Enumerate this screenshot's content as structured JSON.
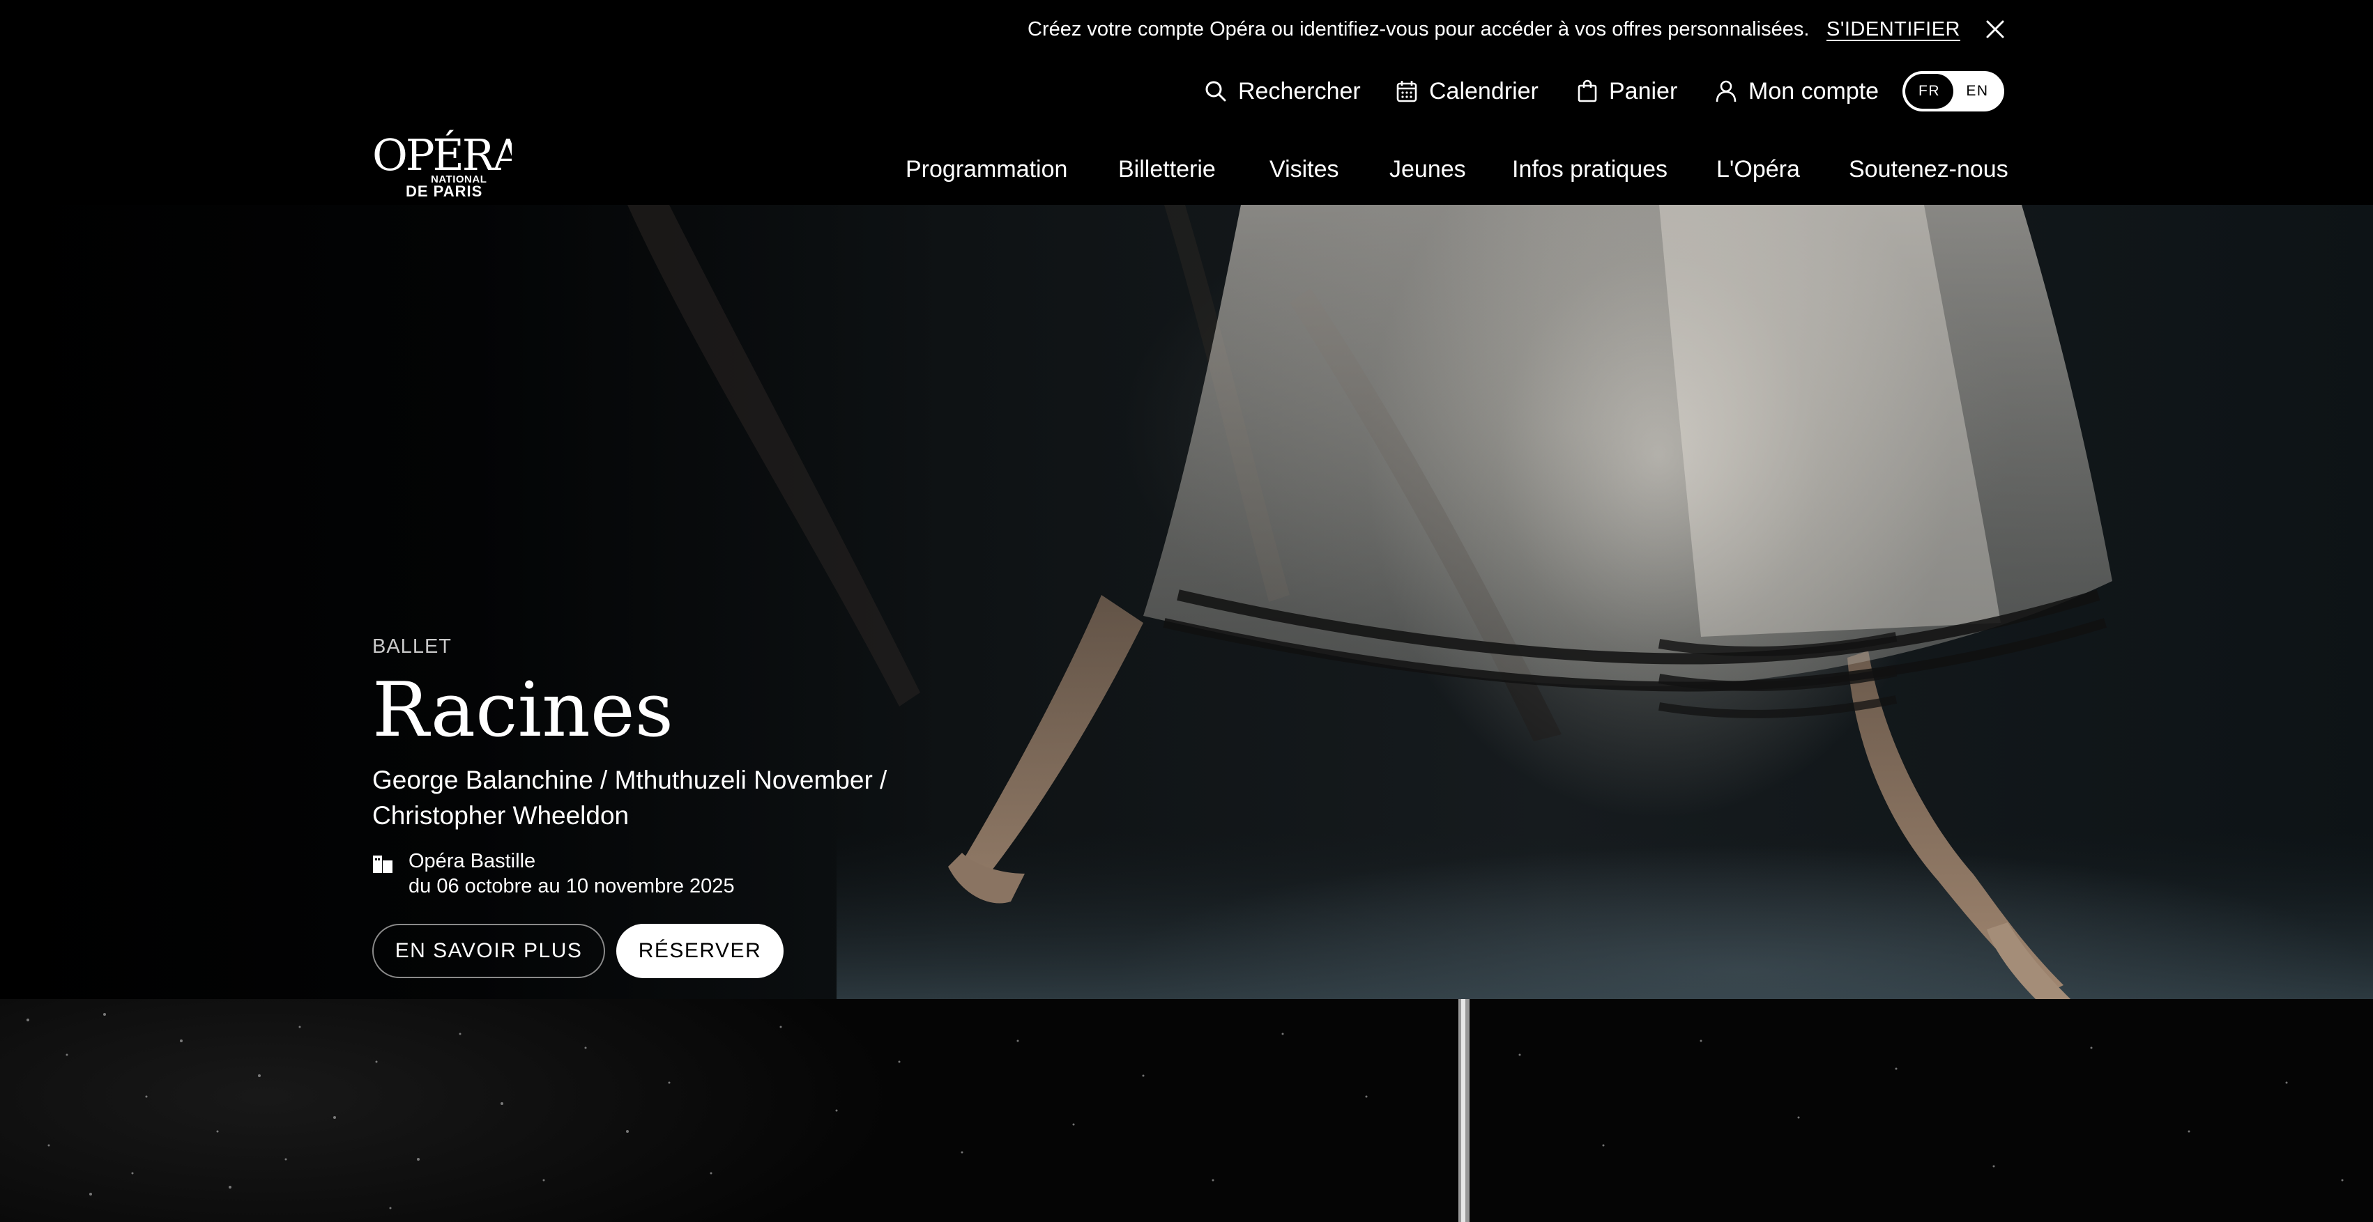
{
  "notice": {
    "text": "Créez votre compte Opéra ou identifiez-vous pour accéder à vos offres personnalisées.",
    "link": "S'IDENTIFIER",
    "close_icon": "close-icon"
  },
  "utility": {
    "search": "Rechercher",
    "calendar": "Calendrier",
    "cart": "Panier",
    "account": "Mon compte",
    "languages": [
      "FR",
      "EN"
    ],
    "active_language": "FR"
  },
  "logo": {
    "line1": "OPÉRA",
    "line2": "NATIONAL",
    "line3": "DE PARIS"
  },
  "nav": {
    "items": [
      "Programmation",
      "Billetterie",
      "Visites",
      "Jeunes",
      "Infos pratiques",
      "L'Opéra",
      "Soutenez-nous"
    ]
  },
  "hero": {
    "category": "BALLET",
    "title": "Racines",
    "subtitle_line1": "George Balanchine / Mthuthuzeli November /",
    "subtitle_line2": "Christopher Wheeldon",
    "venue": "Opéra Bastille",
    "dates": "du 06 octobre au 10 novembre 2025",
    "btn_more": "EN SAVOIR PLUS",
    "btn_book": "RÉSERVER",
    "image": "ballet dancer en pointe in white tulle skirt"
  },
  "colors": {
    "background": "#000000",
    "text": "#ffffff",
    "muted": "#c9c9c9"
  }
}
